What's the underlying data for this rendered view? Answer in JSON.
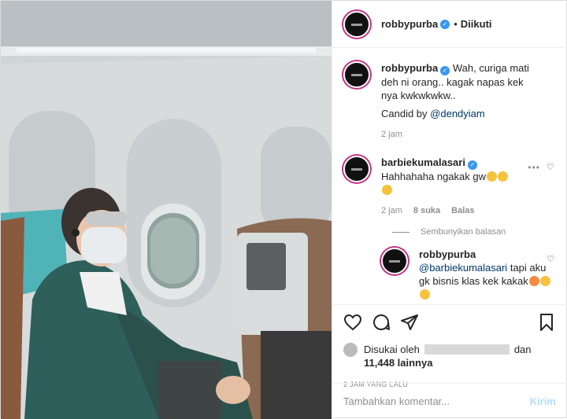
{
  "post": {
    "username": "robbypurba",
    "follow_status": "Diikuti",
    "separator": "•"
  },
  "comments": [
    {
      "username": "robbypurba",
      "text": "Wah, curiga mati deh ni orang.. kagak napas kek nya kwkwkwkw..",
      "text2": "Candid by",
      "mention": "@dendyiam",
      "time": "2 jam"
    },
    {
      "username": "barbiekumalasari",
      "text": "Hahhahaha ngakak gw",
      "time": "2 jam",
      "likes": "8 suka",
      "reply_label": "Balas"
    }
  ],
  "hide_replies": "Sembunyikan balasan",
  "reply": {
    "username": "robbypurba",
    "mention": "@barbiekumalasari",
    "text": "tapi aku gk bisnis klas kek kakak"
  },
  "likes": {
    "prefix": "Disukai oleh",
    "middle": "dan",
    "count": "11,448 lainnya"
  },
  "timestamp": "2 JAM YANG LALU",
  "comment_box": {
    "placeholder": "Tambahkan komentar...",
    "send_label": "Kirim"
  },
  "icons": [
    "heart-icon",
    "comment-icon",
    "share-icon",
    "bookmark-icon",
    "more-icon",
    "verified-icon"
  ],
  "colors": {
    "link": "#00376b",
    "verified": "#3897f0",
    "muted": "#8e8e8e",
    "send_disabled": "#b2dffc"
  }
}
